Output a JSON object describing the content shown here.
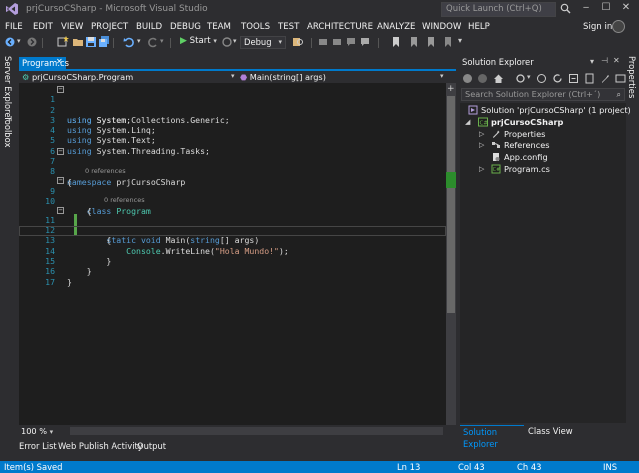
{
  "window": {
    "title": "prjCursoCSharp - Microsoft Visual Studio",
    "quick_launch_placeholder": "Quick Launch (Ctrl+Q)",
    "minimize": "‒",
    "maximize": "☐",
    "close": "✕"
  },
  "menu": {
    "items": [
      "FILE",
      "EDIT",
      "VIEW",
      "PROJECT",
      "BUILD",
      "DEBUG",
      "TEAM",
      "TOOLS",
      "TEST",
      "ARCHITECTURE",
      "ANALYZE",
      "WINDOW",
      "HELP"
    ],
    "sign_in": "Sign in"
  },
  "toolbar": {
    "start_label": "Start",
    "configuration": "Debug"
  },
  "left_strip": {
    "server_explorer": "Server Explorer",
    "toolbox": "Toolbox"
  },
  "editor": {
    "tab_label": "Program.cs",
    "tab_close": "✕",
    "nav_class": "prjCursoCSharp.Program",
    "nav_member": "Main(string[] args)",
    "codelens": "0 references",
    "zoom": "100 %",
    "lines": [
      {
        "n": "1",
        "t": "using System;"
      },
      {
        "n": "2",
        "t": "using System.Collections.Generic;"
      },
      {
        "n": "3",
        "t": "using System.Linq;"
      },
      {
        "n": "4",
        "t": "using System.Text;"
      },
      {
        "n": "5",
        "t": "using System.Threading.Tasks;"
      },
      {
        "n": "6",
        "t": ""
      },
      {
        "n": "7",
        "t": "namespace prjCursoCSharp"
      },
      {
        "n": "8",
        "t": "{"
      },
      {
        "n": "9",
        "t": "    class Program"
      },
      {
        "n": "10",
        "t": "    {"
      },
      {
        "n": "11",
        "t": "        static void Main(string[] args)"
      },
      {
        "n": "12",
        "t": "        {"
      },
      {
        "n": "13",
        "t": "            Console.WriteLine(\"Hola Mundo!\");"
      },
      {
        "n": "14",
        "t": "        }"
      },
      {
        "n": "15",
        "t": "    }"
      },
      {
        "n": "16",
        "t": "}"
      },
      {
        "n": "17",
        "t": ""
      }
    ]
  },
  "bottom_tabs": [
    "Error List",
    "Web Publish Activity",
    "Output"
  ],
  "status": {
    "message": "Item(s) Saved",
    "line": "Ln 13",
    "col": "Col 43",
    "ch": "Ch 43",
    "mode": "INS"
  },
  "solution_explorer": {
    "title": "Solution Explorer",
    "search_placeholder": "Search Solution Explorer (Ctrl+´)",
    "tree": [
      {
        "label": "Solution 'prjCursoCSharp' (1 project)",
        "icon": "solution-icon"
      },
      {
        "label": "prjCursoCSharp",
        "icon": "csharp-project-icon"
      },
      {
        "label": "Properties",
        "icon": "wrench-icon"
      },
      {
        "label": "References",
        "icon": "references-icon"
      },
      {
        "label": "App.config",
        "icon": "config-file-icon"
      },
      {
        "label": "Program.cs",
        "icon": "csharp-file-icon"
      }
    ],
    "tab_solution_explorer": "Solution Explorer",
    "tab_class_view": "Class View",
    "properties_tab": "Properties"
  }
}
